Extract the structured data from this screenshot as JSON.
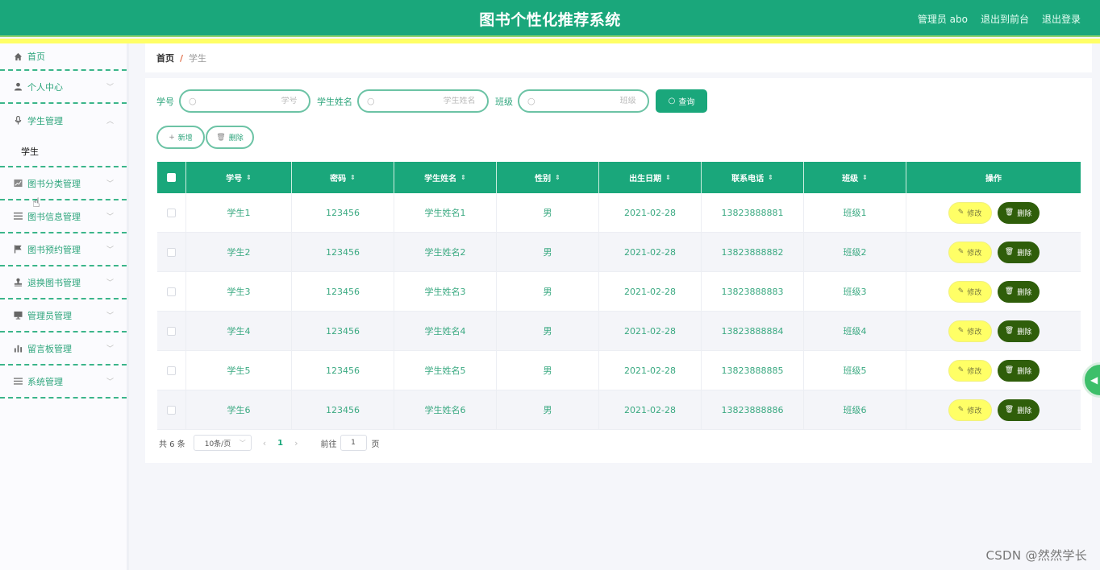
{
  "header": {
    "title": "图书个性化推荐系统",
    "user_label": "管理员 abo",
    "back_to_front": "退出到前台",
    "logout": "退出登录"
  },
  "sidebar": {
    "items": [
      {
        "label": "首页",
        "icon": "home-icon",
        "expandable": false
      },
      {
        "label": "个人中心",
        "icon": "user-icon",
        "expandable": true,
        "expanded": false
      },
      {
        "label": "学生管理",
        "icon": "microphone-icon",
        "expandable": true,
        "expanded": true,
        "children": [
          {
            "label": "学生"
          }
        ]
      },
      {
        "label": "图书分类管理",
        "icon": "chart-icon",
        "expandable": true,
        "expanded": false
      },
      {
        "label": "图书信息管理",
        "icon": "list-icon",
        "expandable": true,
        "expanded": false
      },
      {
        "label": "图书预约管理",
        "icon": "flag-icon",
        "expandable": true,
        "expanded": false
      },
      {
        "label": "退换图书管理",
        "icon": "stamp-icon",
        "expandable": true,
        "expanded": false
      },
      {
        "label": "管理员管理",
        "icon": "monitor-icon",
        "expandable": true,
        "expanded": false
      },
      {
        "label": "留言板管理",
        "icon": "bar-chart-icon",
        "expandable": true,
        "expanded": false
      },
      {
        "label": "系统管理",
        "icon": "menu-icon",
        "expandable": true,
        "expanded": false
      }
    ]
  },
  "breadcrumb": {
    "home": "首页",
    "separator": "/",
    "current": "学生"
  },
  "search": {
    "fields": [
      {
        "label": "学号",
        "placeholder": "学号",
        "value": ""
      },
      {
        "label": "学生姓名",
        "placeholder": "学生姓名",
        "value": ""
      },
      {
        "label": "班级",
        "placeholder": "班级",
        "value": ""
      }
    ],
    "query_label": "查询"
  },
  "actions": {
    "add_label": "新增",
    "delete_label": "删除"
  },
  "table": {
    "columns": [
      "学号",
      "密码",
      "学生姓名",
      "性别",
      "出生日期",
      "联系电话",
      "班级",
      "操作"
    ],
    "rows": [
      {
        "student_no": "学生1",
        "password": "123456",
        "name": "学生姓名1",
        "gender": "男",
        "birth": "2021-02-28",
        "phone": "13823888881",
        "class": "班级1"
      },
      {
        "student_no": "学生2",
        "password": "123456",
        "name": "学生姓名2",
        "gender": "男",
        "birth": "2021-02-28",
        "phone": "13823888882",
        "class": "班级2"
      },
      {
        "student_no": "学生3",
        "password": "123456",
        "name": "学生姓名3",
        "gender": "男",
        "birth": "2021-02-28",
        "phone": "13823888883",
        "class": "班级3"
      },
      {
        "student_no": "学生4",
        "password": "123456",
        "name": "学生姓名4",
        "gender": "男",
        "birth": "2021-02-28",
        "phone": "13823888884",
        "class": "班级4"
      },
      {
        "student_no": "学生5",
        "password": "123456",
        "name": "学生姓名5",
        "gender": "男",
        "birth": "2021-02-28",
        "phone": "13823888885",
        "class": "班级5"
      },
      {
        "student_no": "学生6",
        "password": "123456",
        "name": "学生姓名6",
        "gender": "男",
        "birth": "2021-02-28",
        "phone": "13823888886",
        "class": "班级6"
      }
    ],
    "edit_label": "修改",
    "delete_label": "删除"
  },
  "pagination": {
    "total_text": "共 6 条",
    "page_size": "10条/页",
    "current_page": "1",
    "goto_label": "前往",
    "goto_value": "1",
    "page_suffix": "页"
  },
  "watermark": "CSDN @然然学长",
  "colors": {
    "primary": "#1aa77b",
    "accent_bar": "#ffff66",
    "edit_button": "#ffff66",
    "delete_button": "#2f5e0a"
  }
}
